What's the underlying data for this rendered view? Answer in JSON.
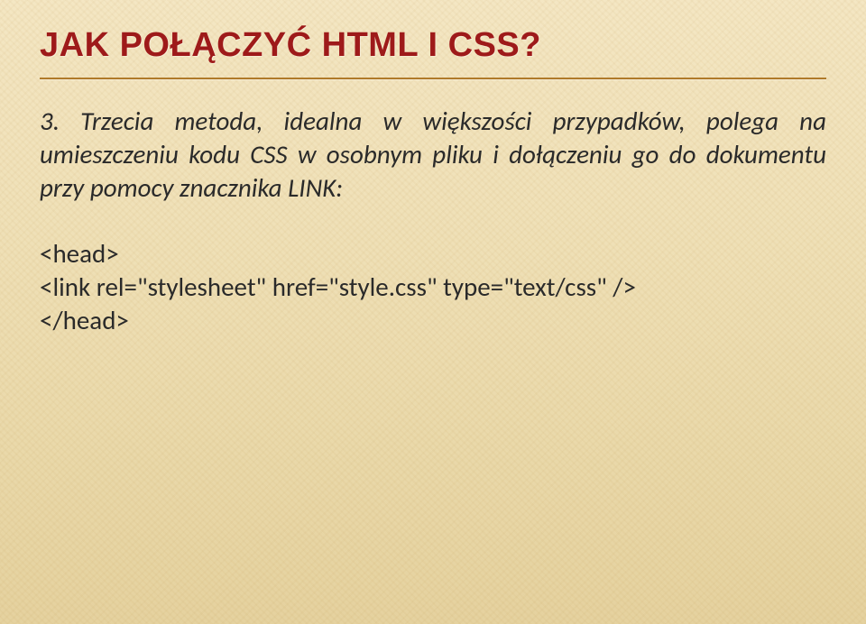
{
  "title": "JAK POŁĄCZYĆ HTML I CSS?",
  "paragraph": "3. Trzecia metoda, idealna w większości przypadków, polega na umieszczeniu kodu CSS w osobnym pliku i dołączeniu go do dokumentu przy pomocy znacznika LINK:",
  "code": {
    "line1": "<head>",
    "line2": "<link rel=\"stylesheet\" href=\"style.css\" type=\"text/css\" />",
    "line3": "</head>"
  }
}
